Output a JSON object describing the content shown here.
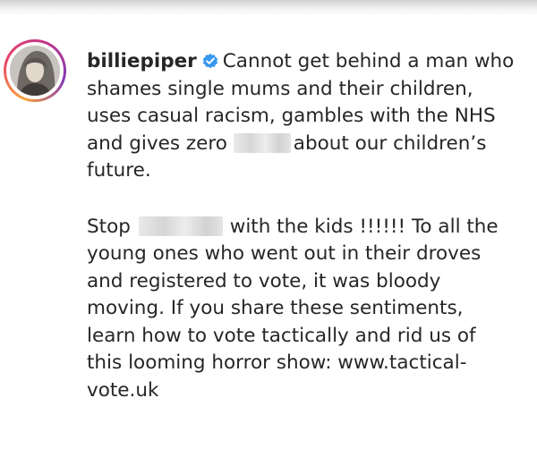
{
  "post": {
    "username": "billiepiper",
    "verified_icon": "verified-badge-icon",
    "para1_start": "Cannot get behind a man who shames single mums and their children, uses casual racism, gambles with the NHS and gives zero",
    "para1_end": "about our children’s future.",
    "para2_start": "Stop",
    "para2_end": "with the kids !!!!!! To all the young ones who went out in their droves and registered to vote, it was bloody moving. If you share these sentiments, learn how to vote tactically and rid us of this looming horror show: www.tactical-vote.uk"
  },
  "colors": {
    "text": "#262626",
    "verified": "#3897f0",
    "ring_start": "#f9a33a",
    "ring_end": "#c13584"
  }
}
